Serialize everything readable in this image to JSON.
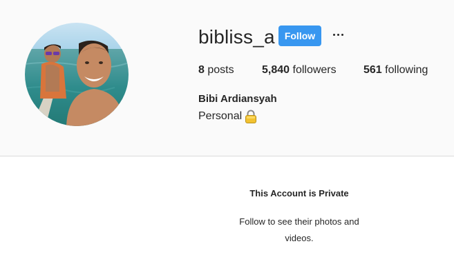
{
  "profile": {
    "username": "bibliss_a",
    "follow_label": "Follow",
    "more_icon": "more-horizontal-icon",
    "stats": {
      "posts_count": "8",
      "posts_label": "posts",
      "followers_count": "5,840",
      "followers_label": "followers",
      "following_count": "561",
      "following_label": "following"
    },
    "full_name": "Bibi Ardiansyah",
    "bio": "Personal",
    "bio_icon": "lock-icon"
  },
  "private_notice": {
    "title": "This Account is Private",
    "subtitle": "Follow to see their photos and videos."
  },
  "colors": {
    "accent": "#3897f0",
    "header_bg": "#fafafa",
    "text": "#262626",
    "divider": "#dbdbdb"
  }
}
